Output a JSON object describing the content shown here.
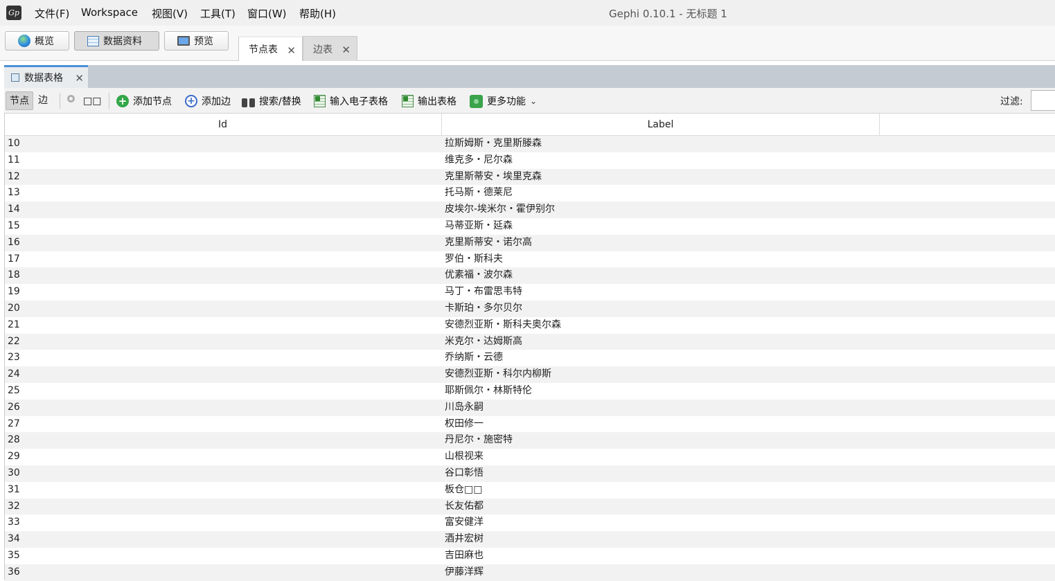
{
  "app": {
    "title": "Gephi 0.10.1 - 无标题 1",
    "logo_text": "Gp"
  },
  "menu": {
    "items": [
      "文件(F)",
      "Workspace",
      "视图(V)",
      "工具(T)",
      "窗口(W)",
      "帮助(H)"
    ]
  },
  "perspectives": {
    "overview": "概览",
    "data_lab": "数据资料",
    "preview": "预览",
    "active": "数据资料"
  },
  "doc_tabs": {
    "nodes": "节点表",
    "edges": "边表",
    "active": "节点表"
  },
  "panel": {
    "tab_label": "数据表格"
  },
  "toolbar": {
    "nodes_toggle": "节点",
    "edges_toggle": "边",
    "config_label": "□□",
    "add_node": "添加节点",
    "add_edge": "添加边",
    "search_replace": "搜索/替换",
    "import_spreadsheet": "输入电子表格",
    "export_table": "输出表格",
    "more_actions": "更多功能",
    "filter_label": "过滤:",
    "filter_value": ""
  },
  "table": {
    "columns": [
      "Id",
      "Label"
    ],
    "rows": [
      {
        "id": "10",
        "label": "拉斯姆斯・克里斯滕森"
      },
      {
        "id": "11",
        "label": "维克多・尼尔森"
      },
      {
        "id": "12",
        "label": "克里斯蒂安・埃里克森"
      },
      {
        "id": "13",
        "label": "托马斯・德莱尼"
      },
      {
        "id": "14",
        "label": "皮埃尔-埃米尔・霍伊别尔"
      },
      {
        "id": "15",
        "label": "马蒂亚斯・延森"
      },
      {
        "id": "16",
        "label": "克里斯蒂安・诺尔高"
      },
      {
        "id": "17",
        "label": "罗伯・斯科夫"
      },
      {
        "id": "18",
        "label": "优素福・波尔森"
      },
      {
        "id": "19",
        "label": "马丁・布雷思韦特"
      },
      {
        "id": "20",
        "label": "卡斯珀・多尔贝尔"
      },
      {
        "id": "21",
        "label": "安德烈亚斯・斯科夫奥尔森"
      },
      {
        "id": "22",
        "label": "米克尔・达姆斯高"
      },
      {
        "id": "23",
        "label": "乔纳斯・云德"
      },
      {
        "id": "24",
        "label": "安德烈亚斯・科尔内柳斯"
      },
      {
        "id": "25",
        "label": "耶斯佩尔・林斯特伦"
      },
      {
        "id": "26",
        "label": "川岛永嗣"
      },
      {
        "id": "27",
        "label": "权田修一"
      },
      {
        "id": "28",
        "label": "丹尼尔・施密特"
      },
      {
        "id": "29",
        "label": "山根视来"
      },
      {
        "id": "30",
        "label": "谷口彰悟"
      },
      {
        "id": "31",
        "label": "板仓□□"
      },
      {
        "id": "32",
        "label": "长友佑都"
      },
      {
        "id": "33",
        "label": "富安健洋"
      },
      {
        "id": "34",
        "label": "酒井宏树"
      },
      {
        "id": "35",
        "label": "吉田麻也"
      },
      {
        "id": "36",
        "label": "伊藤洋辉"
      }
    ]
  }
}
